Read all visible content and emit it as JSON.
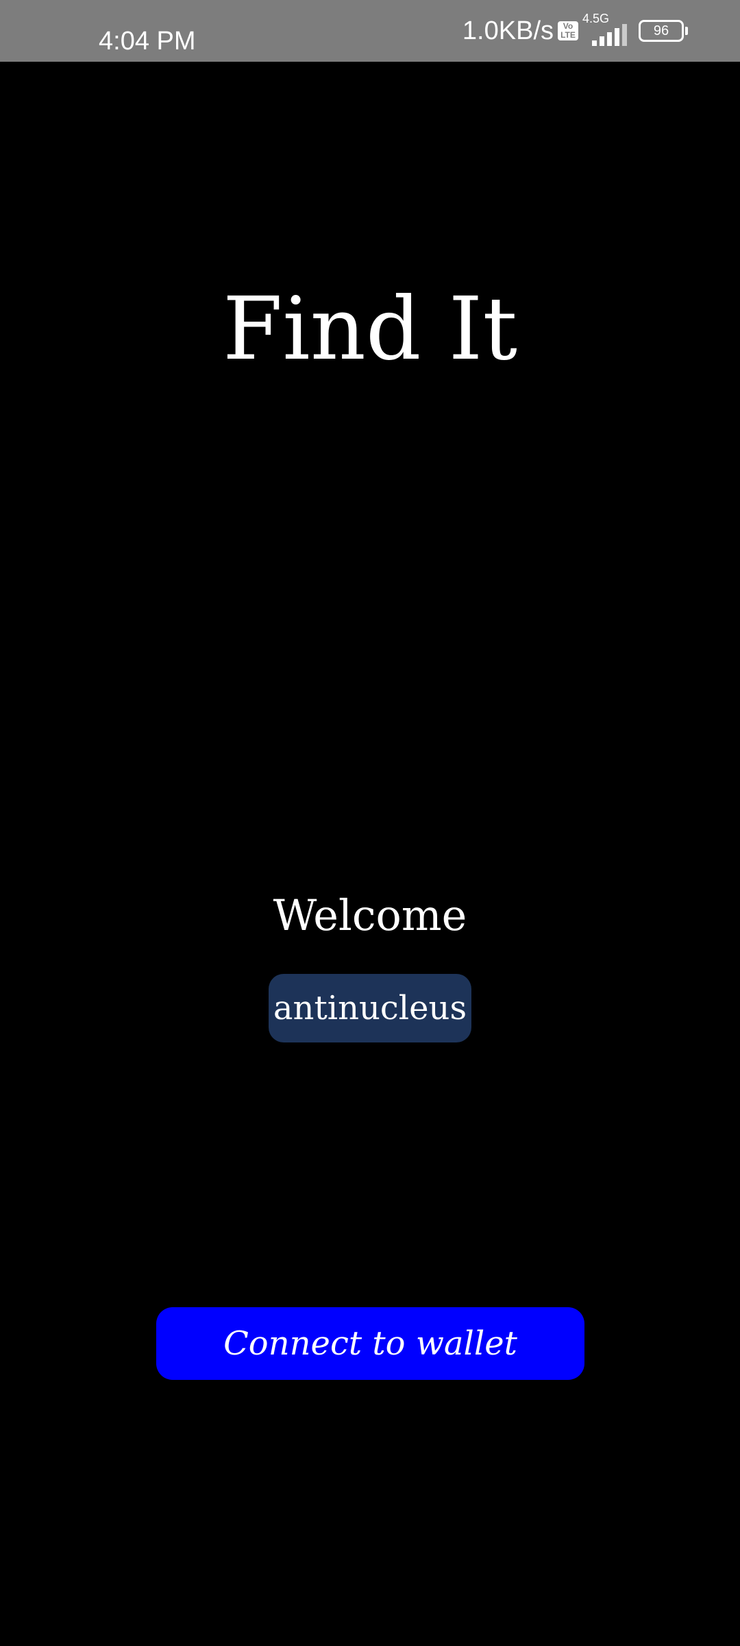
{
  "status_bar": {
    "time": "4:04 PM",
    "net_speed": "1.0KB/s",
    "volte_top": "Vo",
    "volte_bottom": "LTE",
    "network_type": "4.5G",
    "battery_level": "96",
    "background_color": "#7d7d7d"
  },
  "app": {
    "title": "Find It",
    "welcome": "Welcome",
    "username": "antinucleus",
    "connect_label": "Connect to wallet"
  },
  "colors": {
    "background": "#000000",
    "username_chip": "#1d3358",
    "connect_button": "#0000ff",
    "text": "#ffffff"
  },
  "icons": {
    "volte": "volte-icon",
    "signal": "signal-strength-icon",
    "battery": "battery-icon"
  }
}
